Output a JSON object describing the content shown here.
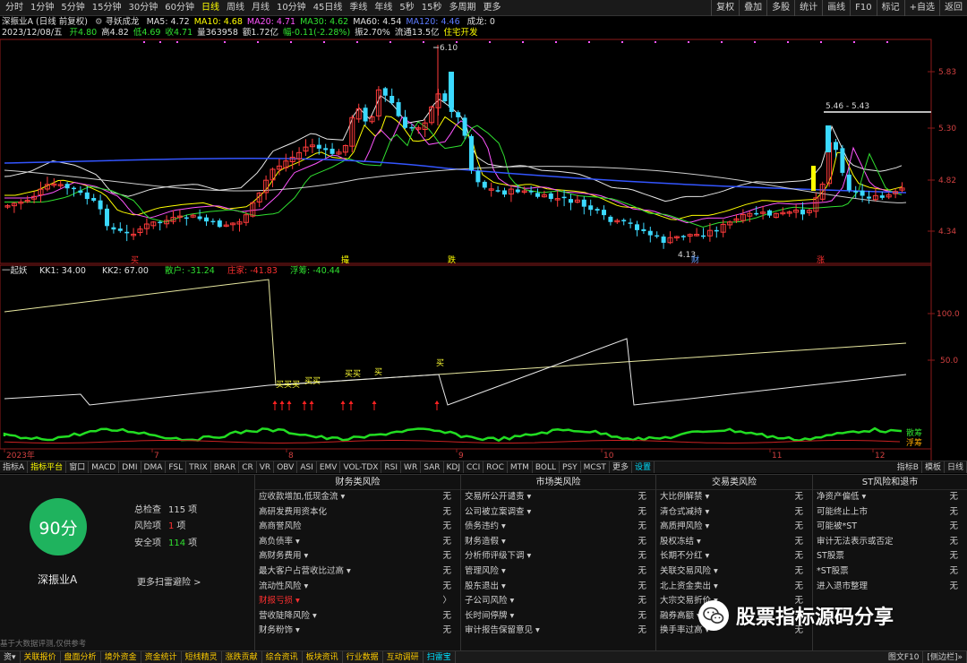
{
  "timeframes": [
    "分时",
    "1分钟",
    "5分钟",
    "15分钟",
    "30分钟",
    "60分钟",
    "日线",
    "周线",
    "月线",
    "10分钟",
    "45日线",
    "季线",
    "年线",
    "5秒",
    "15秒",
    "多周期",
    "更多"
  ],
  "active_timeframe_index": 6,
  "tools": [
    "复权",
    "叠加",
    "多股",
    "统计",
    "画线",
    "F10",
    "标记",
    "+自选",
    "返回"
  ],
  "stock": {
    "name_line": "深振业A (日线 前复权)",
    "indicator_name": "寻妖成龙",
    "ma": [
      {
        "label": "MA5: 4.72",
        "color": "#e0e0e0"
      },
      {
        "label": "MA10: 4.68",
        "color": "#ffff00"
      },
      {
        "label": "MA20: 4.71",
        "color": "#ff55ff"
      },
      {
        "label": "MA30: 4.62",
        "color": "#30e030"
      },
      {
        "label": "MA60: 4.54",
        "color": "#e0e0e0"
      },
      {
        "label": "MA120: 4.46",
        "color": "#5d7bff"
      }
    ],
    "ma_tail": "成龙: 0",
    "date": "2023/12/08/五",
    "quote": [
      {
        "label": "开4.80",
        "color": "#30e030"
      },
      {
        "label": "高4.82",
        "color": "#e0e0e0"
      },
      {
        "label": "低4.69",
        "color": "#30e030"
      },
      {
        "label": "收4.71",
        "color": "#30e030"
      },
      {
        "label": "量363958",
        "color": "#e0e0e0"
      },
      {
        "label": "额1.72亿",
        "color": "#e0e0e0"
      },
      {
        "label": "幅-0.11(-2.28%)",
        "color": "#30e030"
      },
      {
        "label": "振2.70%",
        "color": "#e0e0e0"
      },
      {
        "label": "流通13.5亿",
        "color": "#e0e0e0"
      },
      {
        "label": "住宅开发",
        "color": "#ffff00"
      }
    ]
  },
  "price_axis": [
    "5.83",
    "5.30",
    "4.82",
    "4.34"
  ],
  "annotations": {
    "high": "6.10",
    "low": "4.13",
    "range": "5.46 - 5.43",
    "signal_red1": "买",
    "signal_green1": "跌",
    "signal_red2": "涨",
    "signal_cai": "财",
    "signal_zhang": "涨",
    "buy_marks": [
      "买买买",
      "买买",
      "买买",
      "买",
      "买"
    ]
  },
  "sub_indicator": {
    "name": "一起妖",
    "items": [
      {
        "label": "KK1: 34.00",
        "color": "#e0e0e0"
      },
      {
        "label": "KK2: 67.00",
        "color": "#e0e0e0"
      },
      {
        "label": "散户: -31.24",
        "color": "#30e030"
      },
      {
        "label": "庄家: -41.83",
        "color": "#ff3030"
      },
      {
        "label": "浮筹: -40.44",
        "color": "#30e030"
      }
    ],
    "axis": [
      "100.0",
      "50.0"
    ],
    "legend_a": "散筹",
    "legend_b": "浮筹"
  },
  "month_axis": [
    "2023年",
    "7",
    "8",
    "9",
    "10",
    "11",
    "12"
  ],
  "indicator_tabs": [
    "指标A",
    "指标平台",
    "窗口",
    "MACD",
    "DMI",
    "DMA",
    "FSL",
    "TRIX",
    "BRAR",
    "CR",
    "VR",
    "OBV",
    "ASI",
    "EMV",
    "VOL-TDX",
    "RSI",
    "WR",
    "SAR",
    "KDJ",
    "CCI",
    "ROC",
    "MTM",
    "BOLL",
    "PSY",
    "MCST",
    "更多",
    "设置"
  ],
  "indicator_tabs_right": [
    "指标B",
    "模板",
    "日线"
  ],
  "risk": {
    "score": "90分",
    "stock_name": "深振业A",
    "total_label": "总检查",
    "total_value": "115",
    "total_unit": "项",
    "risk_label": "风险项",
    "risk_value": "1",
    "risk_unit": "项",
    "safe_label": "安全项",
    "safe_value": "114",
    "safe_unit": "项",
    "more": "更多扫雷避险 >",
    "disclaimer": "基于大数据评测,仅供参考",
    "columns": [
      {
        "title": "财务类风险",
        "items": [
          {
            "label": "应收款增加,低现金流 ▾",
            "val": "无"
          },
          {
            "label": "高研发费用资本化",
            "val": "无"
          },
          {
            "label": "高商誉风险",
            "val": "无"
          },
          {
            "label": "高负债率 ▾",
            "val": "无"
          },
          {
            "label": "高财务费用 ▾",
            "val": "无"
          },
          {
            "label": "最大客户占营收比过高 ▾",
            "val": "无"
          },
          {
            "label": "流动性风险 ▾",
            "val": "无"
          },
          {
            "label": "财报亏损 ▾",
            "val": "〉",
            "warn": true
          },
          {
            "label": "营收陡降风险 ▾",
            "val": "无"
          },
          {
            "label": "财务粉饰 ▾",
            "val": "无"
          }
        ]
      },
      {
        "title": "市场类风险",
        "items": [
          {
            "label": "交易所公开谴责 ▾",
            "val": "无"
          },
          {
            "label": "公司被立案调查 ▾",
            "val": "无"
          },
          {
            "label": "债务违约 ▾",
            "val": "无"
          },
          {
            "label": "财务造假 ▾",
            "val": "无"
          },
          {
            "label": "分析师评级下调 ▾",
            "val": "无"
          },
          {
            "label": "管理风险 ▾",
            "val": "无"
          },
          {
            "label": "股东退出 ▾",
            "val": "无"
          },
          {
            "label": "子公司风险 ▾",
            "val": "无"
          },
          {
            "label": "长时间停牌 ▾",
            "val": "无"
          },
          {
            "label": "审计报告保留意见 ▾",
            "val": "无"
          }
        ]
      },
      {
        "title": "交易类风险",
        "items": [
          {
            "label": "大比例解禁 ▾",
            "val": "无"
          },
          {
            "label": "清仓式减持 ▾",
            "val": "无"
          },
          {
            "label": "高质押风险 ▾",
            "val": "无"
          },
          {
            "label": "股权冻结 ▾",
            "val": "无"
          },
          {
            "label": "长期不分红 ▾",
            "val": "无"
          },
          {
            "label": "关联交易风险 ▾",
            "val": "无"
          },
          {
            "label": "北上资金卖出 ▾",
            "val": "无"
          },
          {
            "label": "大宗交易折价 ▾",
            "val": "无"
          },
          {
            "label": "融券高额 ▾",
            "val": "无"
          },
          {
            "label": "换手率过高 ▾",
            "val": "无"
          }
        ]
      },
      {
        "title": "ST风险和退市",
        "items": [
          {
            "label": "净资产偏低 ▾",
            "val": "无"
          },
          {
            "label": "可能终止上市",
            "val": "无"
          },
          {
            "label": "可能被*ST",
            "val": "无"
          },
          {
            "label": "审计无法表示或否定",
            "val": "无"
          },
          {
            "label": "ST股票",
            "val": "无"
          },
          {
            "label": "*ST股票",
            "val": "无"
          },
          {
            "label": "进入退市整理",
            "val": "无"
          }
        ]
      }
    ]
  },
  "watermark": "股票指标源码分享",
  "bottom_tabs": [
    "资▾",
    "关联报价",
    "盘面分析",
    "境外资金",
    "资金统计",
    "短线精灵",
    "涨跌贡献",
    "综合资讯",
    "板块资讯",
    "行业数据",
    "互动调研",
    "扫雷宝"
  ],
  "bottom_active_index": 11,
  "bottom_right": [
    "图文F10",
    "[侧边栏]»"
  ]
}
